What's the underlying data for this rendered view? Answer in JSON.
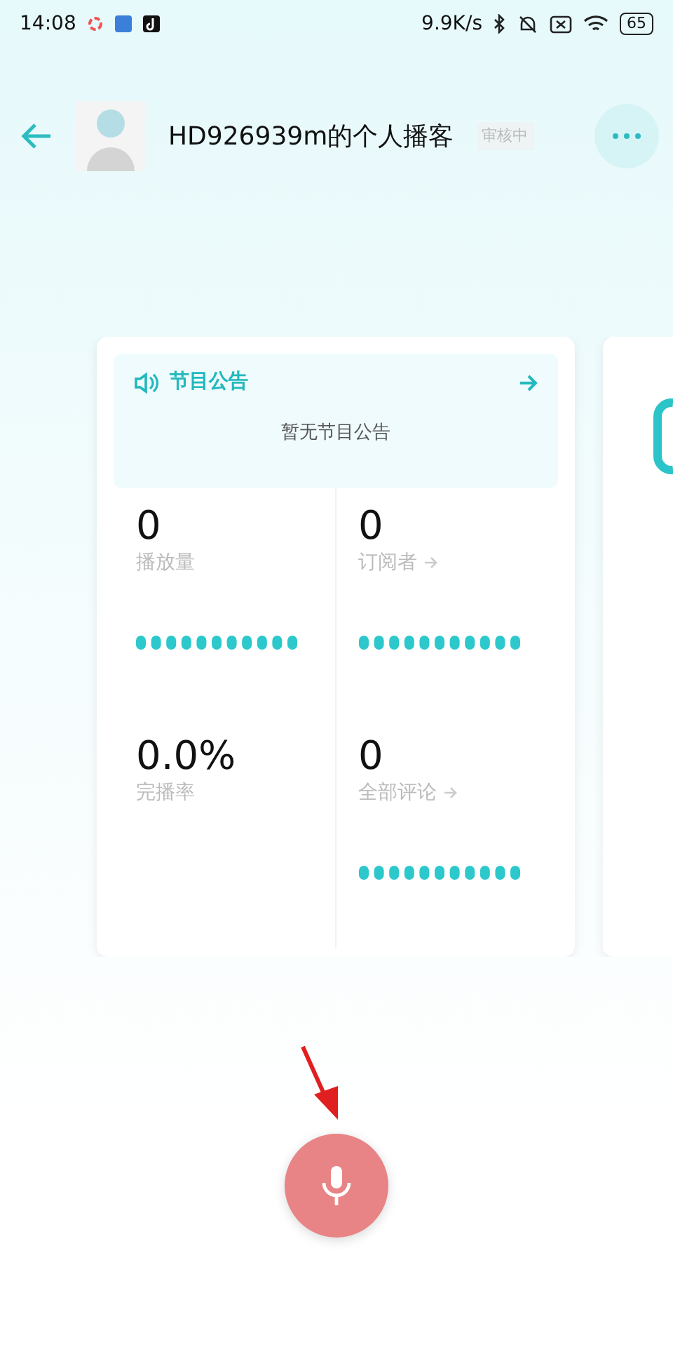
{
  "status_bar": {
    "time": "14:08",
    "speed": "9.9K/s",
    "battery": "65"
  },
  "header": {
    "title": "HD926939m的个人播客",
    "badge": "审核中"
  },
  "announcement": {
    "title": "节目公告",
    "text": "暂无节目公告"
  },
  "stats": [
    {
      "value": "0",
      "label": "播放量",
      "arrow": false,
      "dots": true
    },
    {
      "value": "0",
      "label": "订阅者",
      "arrow": true,
      "dots": true
    },
    {
      "value": "0.0%",
      "label": "完播率",
      "arrow": false,
      "dots": false
    },
    {
      "value": "0",
      "label": "全部评论",
      "arrow": true,
      "dots": true
    }
  ]
}
